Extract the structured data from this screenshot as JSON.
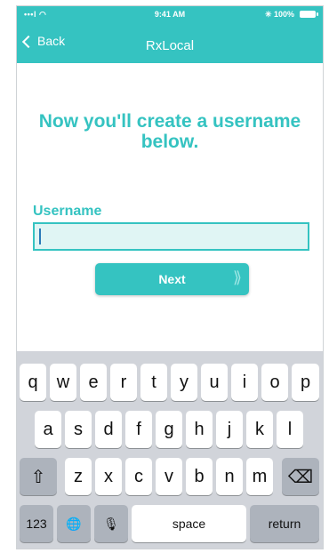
{
  "status_bar": {
    "signal": "•••l ◠",
    "time": "9:41 AM",
    "battery_text": "✳ 100%"
  },
  "nav": {
    "back_label": "Back",
    "title": "RxLocal"
  },
  "main": {
    "headline": "Now you'll create a username below.",
    "username_label": "Username",
    "username_value": "",
    "next_label": "Next",
    "next_arrows": "⟩⟩"
  },
  "keyboard": {
    "row1": [
      "q",
      "w",
      "e",
      "r",
      "t",
      "y",
      "u",
      "i",
      "o",
      "p"
    ],
    "row2": [
      "a",
      "s",
      "d",
      "f",
      "g",
      "h",
      "j",
      "k",
      "l"
    ],
    "row3": [
      "z",
      "x",
      "c",
      "v",
      "b",
      "n",
      "m"
    ],
    "shift": "⇧",
    "delete": "⌫",
    "numbers": "123",
    "globe": "🌐",
    "mic": "🎙",
    "space": "space",
    "return": "return"
  },
  "colors": {
    "accent": "#35c3c1",
    "input_bg": "#e0f5f4",
    "keyboard_bg": "#d1d4da"
  }
}
